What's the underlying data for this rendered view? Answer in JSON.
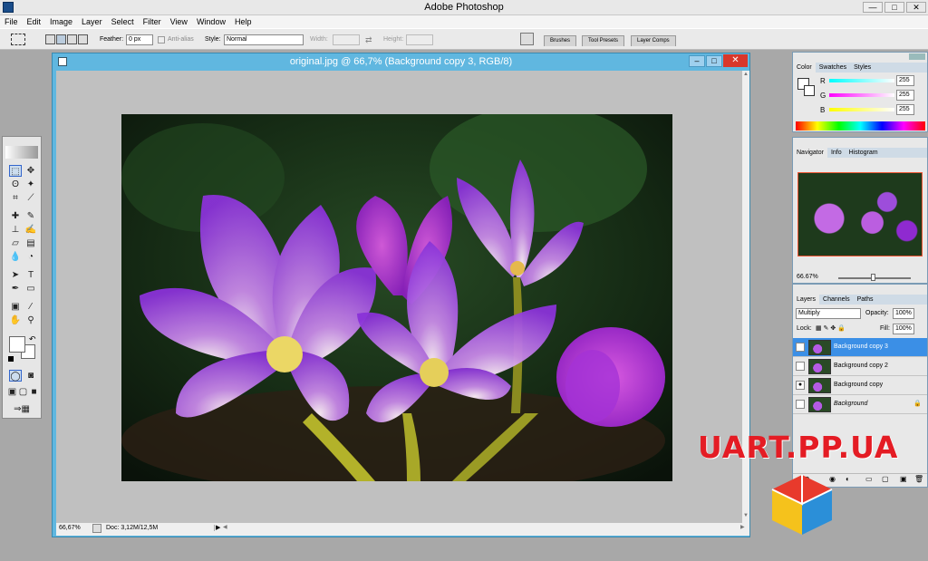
{
  "app": {
    "title": "Adobe Photoshop",
    "min_label": "—",
    "max_label": "□",
    "close_label": "✕"
  },
  "menu": [
    "File",
    "Edit",
    "Image",
    "Layer",
    "Select",
    "Filter",
    "View",
    "Window",
    "Help"
  ],
  "options": {
    "feather_label": "Feather:",
    "feather_value": "0 px",
    "antialias_label": "Anti-alias",
    "style_label": "Style:",
    "style_value": "Normal",
    "width_label": "Width:",
    "height_label": "Height:",
    "wells": [
      "Brushes",
      "Tool Presets",
      "Layer Comps"
    ]
  },
  "document": {
    "title": "original.jpg @ 66,7% (Background copy 3, RGB/8)",
    "zoom": "66,67%",
    "doc_info": "Doc: 3,12M/12,5M"
  },
  "color_panel": {
    "tabs": [
      "Color",
      "Swatches",
      "Styles"
    ],
    "r_label": "R",
    "g_label": "G",
    "b_label": "B",
    "r": "255",
    "g": "255",
    "b": "255"
  },
  "navigator": {
    "tabs": [
      "Navigator",
      "Info",
      "Histogram"
    ],
    "zoom": "66.67%"
  },
  "layers_panel": {
    "tabs": [
      "Layers",
      "Channels",
      "Paths"
    ],
    "blend_mode": "Multiply",
    "opacity_label": "Opacity:",
    "opacity": "100%",
    "lock_label": "Lock:",
    "fill_label": "Fill:",
    "fill": "100%",
    "layers": [
      {
        "name": "Background copy 3",
        "visible": true,
        "selected": true
      },
      {
        "name": "Background copy 2",
        "visible": false,
        "selected": false
      },
      {
        "name": "Background copy",
        "visible": true,
        "selected": false
      },
      {
        "name": "Background",
        "visible": false,
        "selected": false
      }
    ]
  },
  "watermark": "UART.PP.UA",
  "colors": {
    "accent": "#60b7e0",
    "selected": "#3b8fe6",
    "flower": "#9a3ee6"
  }
}
